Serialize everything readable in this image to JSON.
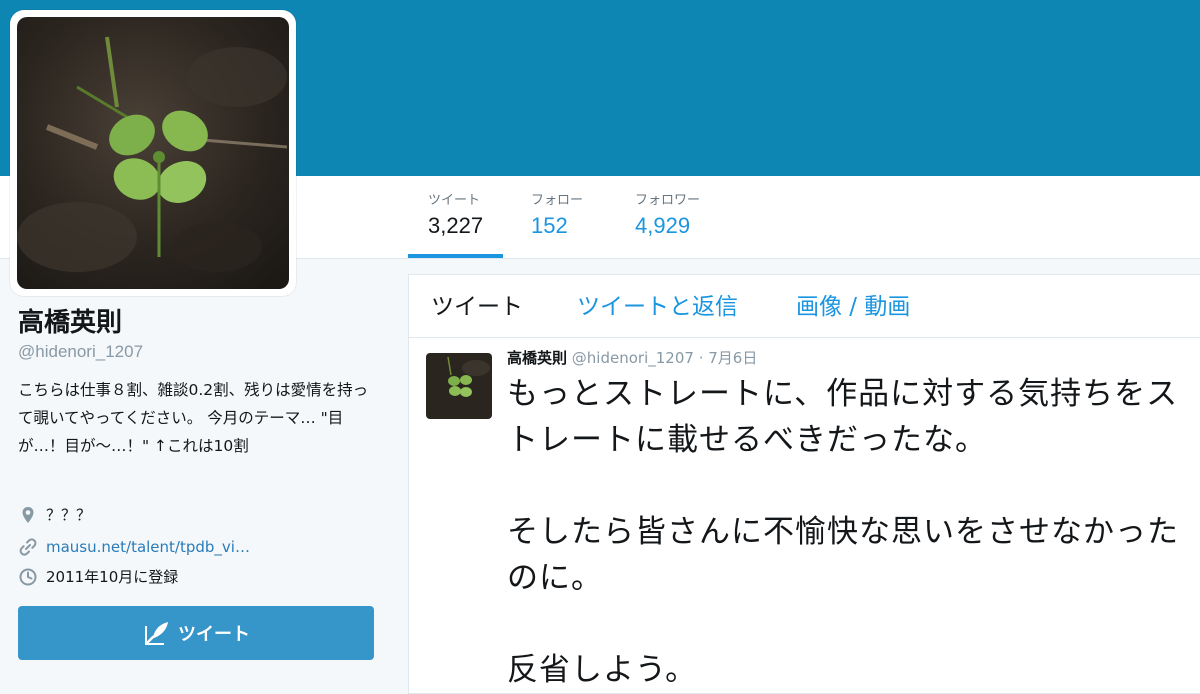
{
  "colors": {
    "banner": "#0e86b4",
    "accent": "#1b95e0",
    "button": "#3696c9"
  },
  "stats": [
    {
      "label": "ツイート",
      "value": "3,227"
    },
    {
      "label": "フォロー",
      "value": "152"
    },
    {
      "label": "フォロワー",
      "value": "4,929"
    }
  ],
  "profile": {
    "name": "高橋英則",
    "handle": "@hidenori_1207",
    "bio": "こちらは仕事８割、雑談0.2割、残りは愛情を持って覗いてやってください。 今月のテーマ… \"目が…！目が～…！\" ↑これは10割",
    "location": "？？？",
    "location_icon": "map-pin-icon",
    "url": "mausu.net/talent/tpdb_vi…",
    "url_icon": "link-icon",
    "joined": "2011年10月に登録",
    "joined_icon": "calendar-clock-icon"
  },
  "compose": {
    "label": "ツイート",
    "icon": "quill-icon"
  },
  "tabs": [
    {
      "label": "ツイート"
    },
    {
      "label": "ツイートと返信"
    },
    {
      "label": "画像 / 動画"
    }
  ],
  "tweet": {
    "author": "高橋英則",
    "handle": "@hidenori_1207",
    "separator": "·",
    "date": "7月6日",
    "text": "もっとストレートに、作品に対する気持ちをストレートに載せるべきだったな。\n\nそしたら皆さんに不愉快な思いをさせなかったのに。\n\n反省しよう。"
  }
}
